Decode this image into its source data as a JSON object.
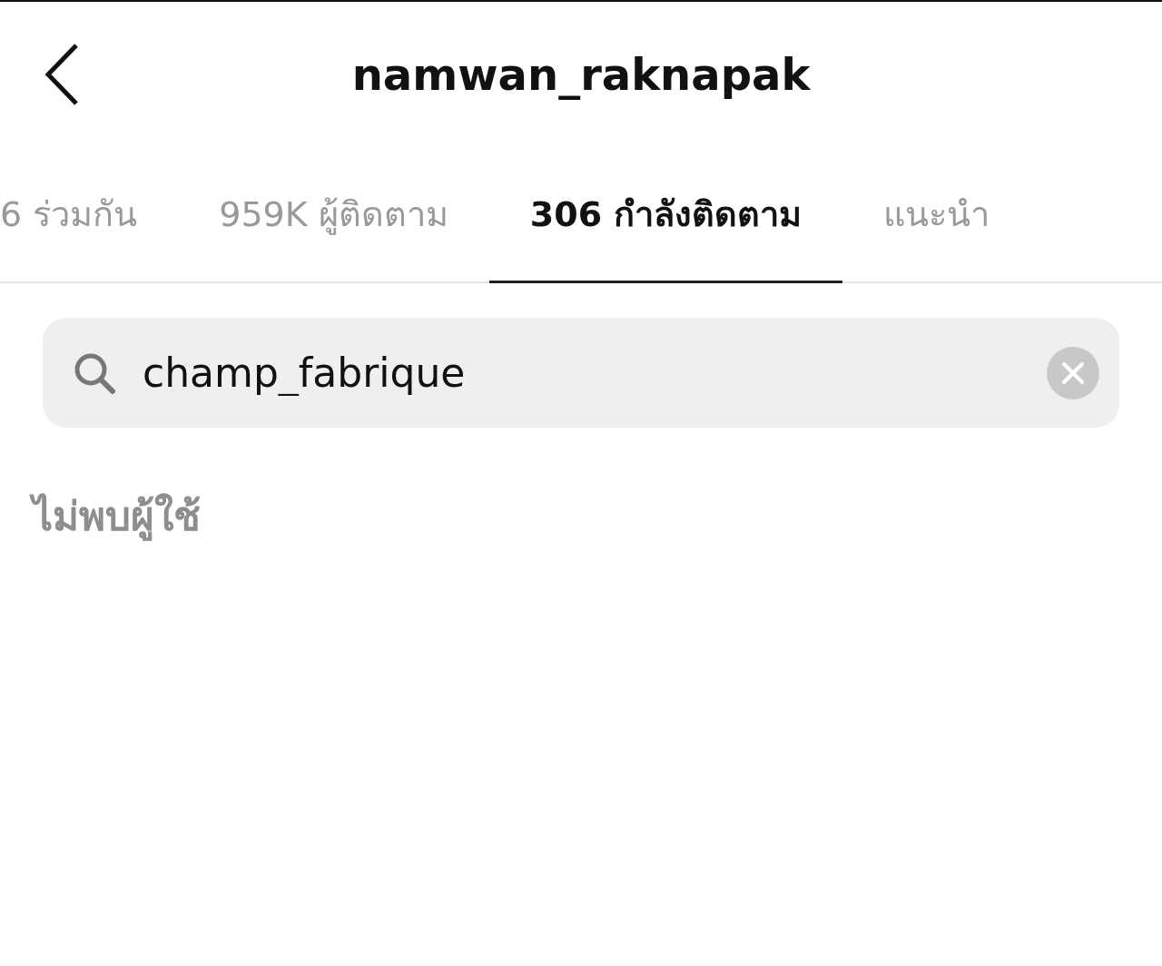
{
  "header": {
    "title": "namwan_raknapak"
  },
  "tabs": [
    {
      "label": "6 ร่วมกัน",
      "selected": false
    },
    {
      "label": "959K ผู้ติดตาม",
      "selected": false
    },
    {
      "label": "306 กำลังติดตาม",
      "selected": true
    },
    {
      "label": "แนะนำ",
      "selected": false
    }
  ],
  "search": {
    "value": "champ_fabrique"
  },
  "empty_message": "ไม่พบผู้ใช้"
}
